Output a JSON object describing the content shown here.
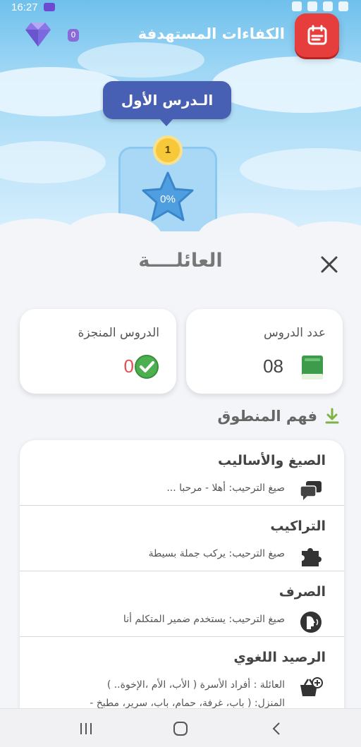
{
  "status_bar": {
    "time": "16:27"
  },
  "header": {
    "title": "الكفاءات المستهدفة",
    "gem_count": "0",
    "accent_red": "#e63d3d"
  },
  "lesson": {
    "bubble_label": "الـدرس الأول",
    "number": "1",
    "progress": "0%"
  },
  "sheet": {
    "title": "العائلــــة",
    "stats": {
      "lessons_label": "عدد الدروس",
      "lessons_value": "08",
      "done_label": "الدروس المنجزة",
      "done_value": "0"
    },
    "section_title": "فهم المنطوق",
    "skills": [
      {
        "title": "الصيغ والأساليب",
        "desc": "صيغ الترحيب: أهلا - مرحبا ...",
        "icon": "chat-bubbles-icon"
      },
      {
        "title": "التراكيب",
        "desc": "صيغ الترحيب: يركب جملة بسيطة",
        "icon": "puzzle-icon"
      },
      {
        "title": "الصرف",
        "desc": "صيغ الترحيب: يستخدم ضمير المتكلم أنا",
        "icon": "speaking-head-icon"
      },
      {
        "title": "الرصيد اللغوي",
        "desc": "العائلة : أفراد الأسرة ( الأب، الأم ،الإخوة.. )",
        "desc2": "المنزل: ( باب، غرفة، حمام، باب، سرير، مطبخ -",
        "icon": "basket-plus-icon"
      }
    ]
  }
}
